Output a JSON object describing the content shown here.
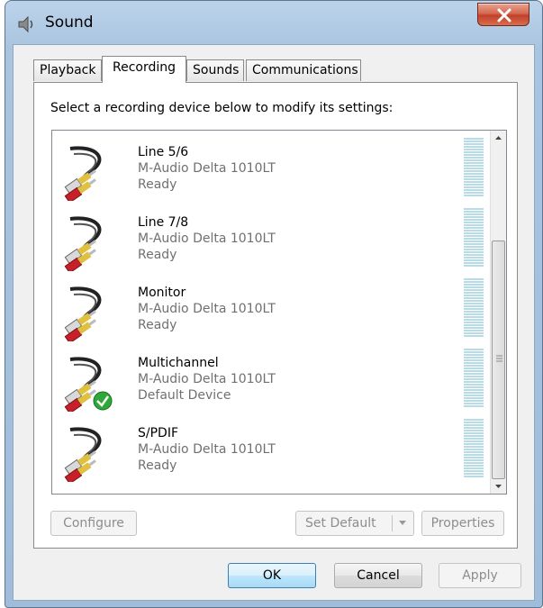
{
  "window": {
    "title": "Sound",
    "close_glyph": "x"
  },
  "tabs": [
    {
      "label": "Playback"
    },
    {
      "label": "Recording"
    },
    {
      "label": "Sounds"
    },
    {
      "label": "Communications"
    }
  ],
  "recording": {
    "instruction": "Select a recording device below to modify its settings:",
    "devices": [
      {
        "name": "Line 5/6",
        "driver": "M-Audio Delta 1010LT",
        "status": "Ready"
      },
      {
        "name": "Line 7/8",
        "driver": "M-Audio Delta 1010LT",
        "status": "Ready"
      },
      {
        "name": "Monitor",
        "driver": "M-Audio Delta 1010LT",
        "status": "Ready"
      },
      {
        "name": "Multichannel",
        "driver": "M-Audio Delta 1010LT",
        "status": "Default Device"
      },
      {
        "name": "S/PDIF",
        "driver": "M-Audio Delta 1010LT",
        "status": "Ready"
      }
    ],
    "configure_label": "Configure",
    "set_default_label": "Set Default",
    "properties_label": "Properties"
  },
  "footer": {
    "ok_label": "OK",
    "cancel_label": "Cancel",
    "apply_label": "Apply"
  },
  "colors": {
    "title_bg": "#a9c4e0",
    "accent_default_button": "#3c7fb1",
    "default_device_check": "#2fa83a",
    "cable_red": "#c8202a"
  },
  "icons": {
    "app": "speaker-icon",
    "device": "rca-cable-icon",
    "default_badge": "green-check-icon"
  }
}
